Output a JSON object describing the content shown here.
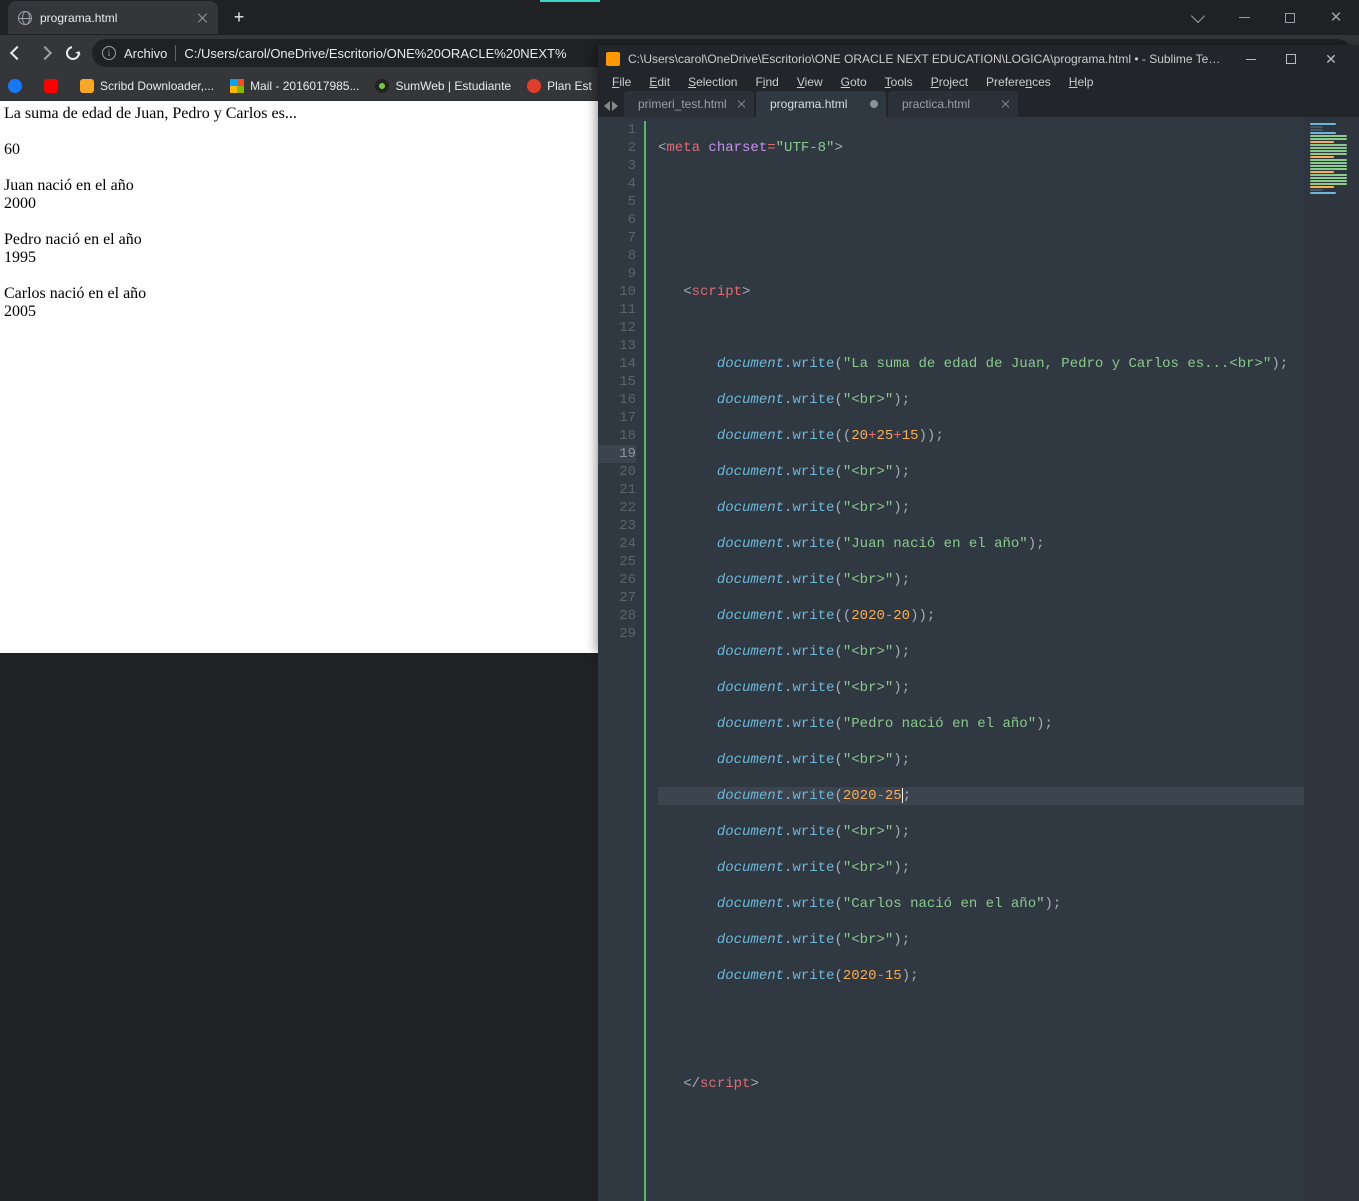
{
  "browser": {
    "tab_title": "programa.html",
    "omnibox_label": "Archivo",
    "omnibox_path": "C:/Users/carol/OneDrive/Escritorio/ONE%20ORACLE%20NEXT%",
    "bookmarks": [
      {
        "label": ""
      },
      {
        "label": ""
      },
      {
        "label": "Scribd Downloader,..."
      },
      {
        "label": "Mail - 2016017985..."
      },
      {
        "label": "SumWeb | Estudiante"
      },
      {
        "label": "Plan Est"
      }
    ],
    "page": {
      "line1": "La suma de edad de Juan, Pedro y Carlos es...",
      "sum": "60",
      "juan_lbl": "Juan nació en el año",
      "juan_year": "2000",
      "pedro_lbl": "Pedro nació en el año",
      "pedro_year": "1995",
      "carlos_lbl": "Carlos nació en el año",
      "carlos_year": "2005"
    }
  },
  "sublime": {
    "title": "C:\\Users\\carol\\OneDrive\\Escritorio\\ONE ORACLE NEXT EDUCATION\\LOGICA\\programa.html • - Sublime Text (UNREGI...",
    "menu": [
      "File",
      "Edit",
      "Selection",
      "Find",
      "View",
      "Goto",
      "Tools",
      "Project",
      "Preferences",
      "Help"
    ],
    "tabs": [
      {
        "label": "primeri_test.html",
        "active": false,
        "dirty": false
      },
      {
        "label": "programa.html",
        "active": true,
        "dirty": true
      },
      {
        "label": "practica.html",
        "active": false,
        "dirty": false
      }
    ],
    "lines": {
      "n1": "1",
      "n2": "2",
      "n3": "3",
      "n4": "4",
      "n5": "5",
      "n6": "6",
      "n7": "7",
      "n8": "8",
      "n9": "9",
      "n10": "10",
      "n11": "11",
      "n12": "12",
      "n13": "13",
      "n14": "14",
      "n15": "15",
      "n16": "16",
      "n17": "17",
      "n18": "18",
      "n19": "19",
      "n20": "20",
      "n21": "21",
      "n22": "22",
      "n23": "23",
      "n24": "24",
      "n25": "25",
      "n26": "26",
      "n27": "27",
      "n28": "28",
      "n29": "29"
    },
    "code": {
      "meta_open": "<",
      "meta_tag": "meta",
      "sp": " ",
      "charset_attr": "charset",
      "eq": "=",
      "utf8": "\"UTF-8\"",
      "close": ">",
      "script_open_tag": "script",
      "doc": "document",
      "dot": ".",
      "write": "write",
      "lp": "(",
      "rp": ")",
      "semi": ";",
      "s_sum": "\"La suma de edad de Juan, Pedro y Carlos es...<br>\"",
      "s_br": "\"<br>\"",
      "expr_sum_a": "20",
      "plus": "+",
      "expr_sum_b": "25",
      "expr_sum_c": "15",
      "s_juan": "\"Juan nació en el año\"",
      "y2020": "2020",
      "minus": "-",
      "n20": "20",
      "n25": "25",
      "n15": "15",
      "s_pedro": "\"Pedro nació en el año\"",
      "s_carlos": "\"Carlos nació en el año\"",
      "end_script_slash": "/",
      "end_script": "script"
    }
  }
}
